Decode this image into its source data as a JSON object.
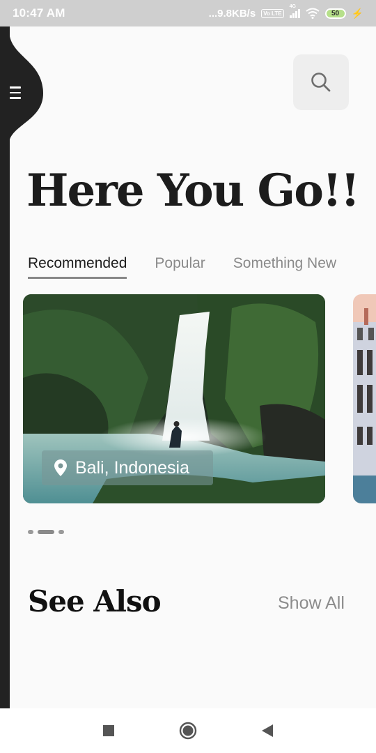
{
  "status_bar": {
    "time": "10:47 AM",
    "net_speed": "...9.8KB/s",
    "volte": "Vo LTE",
    "network": "4G",
    "battery": "50"
  },
  "header": {
    "menu_icon": "hamburger-icon",
    "search_icon": "search-icon"
  },
  "headline": "Here You Go!!",
  "tabs": [
    {
      "label": "Recommended",
      "active": true
    },
    {
      "label": "Popular",
      "active": false
    },
    {
      "label": "Something New",
      "active": false
    }
  ],
  "cards": [
    {
      "location": "Bali, Indonesia",
      "icon": "location-pin-icon",
      "image": "waterfall"
    },
    {
      "location": "",
      "image": "city-buildings"
    }
  ],
  "carousel": {
    "count": 3,
    "active_index": 1
  },
  "see_also": {
    "title": "See Also",
    "show_all_label": "Show All"
  },
  "nav_bar": {
    "items": [
      "recent-apps-icon",
      "home-icon",
      "back-icon"
    ]
  },
  "colors": {
    "accent": "#222222",
    "surface": "#fafafa",
    "chip": "#7a9696"
  }
}
